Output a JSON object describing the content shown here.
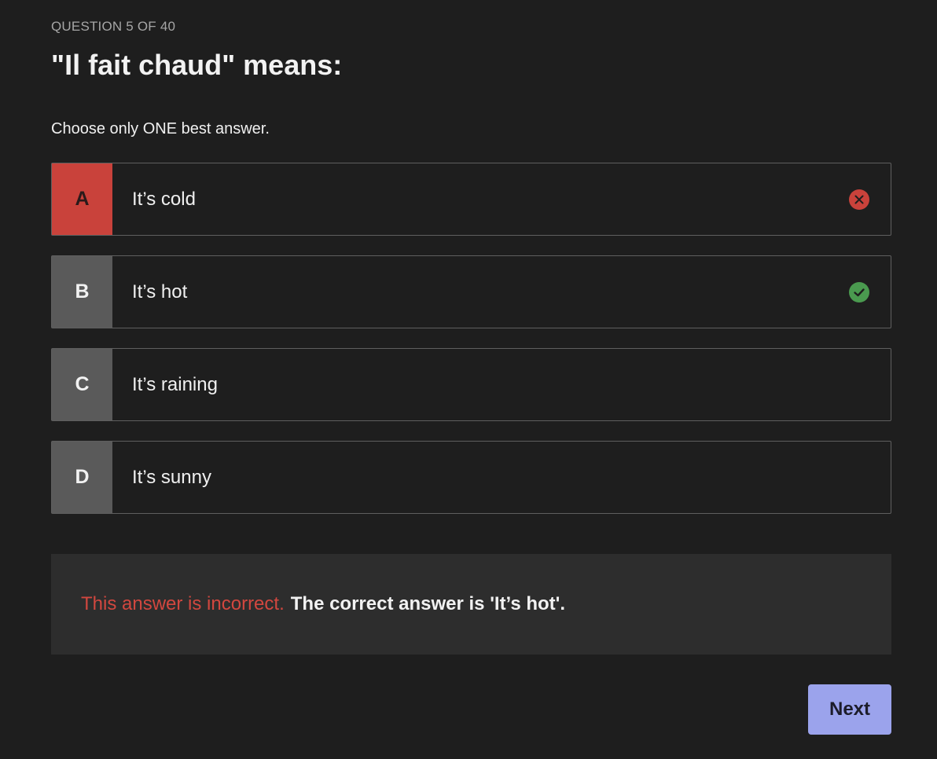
{
  "counter": "QUESTION 5 OF 40",
  "question": "\"Il fait chaud\" means:",
  "instruction": "Choose only ONE best answer.",
  "options": [
    {
      "letter": "A",
      "text": "It’s cold",
      "state": "incorrect",
      "icon": "x-circle-icon"
    },
    {
      "letter": "B",
      "text": "It’s hot",
      "state": "correct",
      "icon": "check-circle-icon"
    },
    {
      "letter": "C",
      "text": "It’s raining",
      "state": "none"
    },
    {
      "letter": "D",
      "text": "It’s sunny",
      "state": "none"
    }
  ],
  "feedback": {
    "status": "This answer is incorrect.",
    "message": "The correct answer is 'It’s hot'."
  },
  "next_label": "Next",
  "colors": {
    "background": "#1e1e1e",
    "incorrect": "#c9423b",
    "correct": "#4a9a4f",
    "next_button": "#9ba3ec"
  }
}
